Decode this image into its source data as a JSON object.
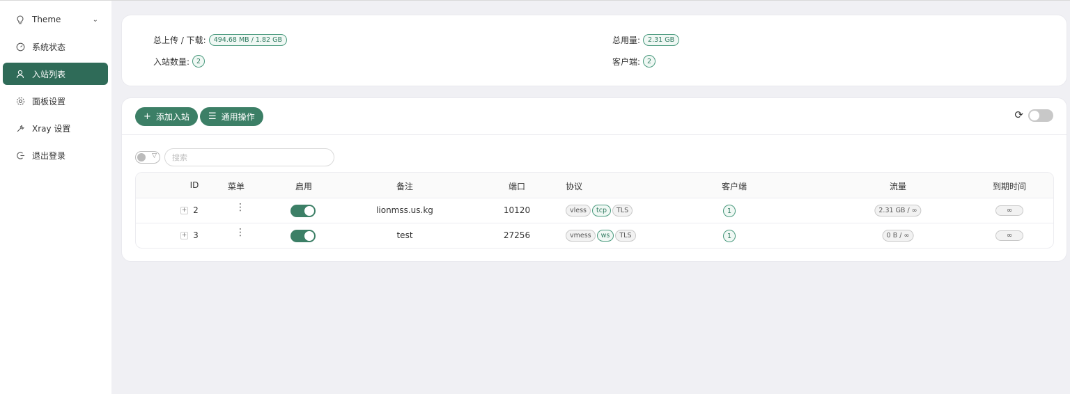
{
  "sidebar": {
    "items": [
      {
        "label": "Theme",
        "icon": "bulb-icon",
        "active": false,
        "has_chevron": true
      },
      {
        "label": "系统状态",
        "icon": "dashboard-icon",
        "active": false
      },
      {
        "label": "入站列表",
        "icon": "user-icon",
        "active": true
      },
      {
        "label": "面板设置",
        "icon": "gear-icon",
        "active": false
      },
      {
        "label": "Xray 设置",
        "icon": "wrench-icon",
        "active": false
      },
      {
        "label": "退出登录",
        "icon": "logout-icon",
        "active": false
      }
    ]
  },
  "stats": {
    "upload_download_label": "总上传 / 下载:",
    "upload_download_value": "494.68 MB / 1.82 GB",
    "total_usage_label": "总用量:",
    "total_usage_value": "2.31 GB",
    "inbound_count_label": "入站数量:",
    "inbound_count_value": "2",
    "clients_label": "客户端:",
    "clients_value": "2"
  },
  "toolbar": {
    "add_inbound_label": "添加入站",
    "general_actions_label": "通用操作",
    "auto_refresh_on": false
  },
  "search": {
    "placeholder": "搜索",
    "filter_on": false
  },
  "table": {
    "headers": [
      "ID",
      "菜单",
      "启用",
      "备注",
      "端口",
      "协议",
      "客户端",
      "流量",
      "到期时间"
    ],
    "rows": [
      {
        "id": "2",
        "enabled": true,
        "remark": "lionmss.us.kg",
        "port": "10120",
        "protocol": "vless",
        "transport": "tcp",
        "security": "TLS",
        "clients": "1",
        "traffic": "2.31 GB / ∞",
        "expiry": "∞"
      },
      {
        "id": "3",
        "enabled": true,
        "remark": "test",
        "port": "27256",
        "protocol": "vmess",
        "transport": "ws",
        "security": "TLS",
        "clients": "1",
        "traffic": "0 B / ∞",
        "expiry": "∞"
      }
    ]
  },
  "colors": {
    "accent": "#3c7f66",
    "sidebar_active": "#2f6b58",
    "background": "#f0f0f4"
  }
}
